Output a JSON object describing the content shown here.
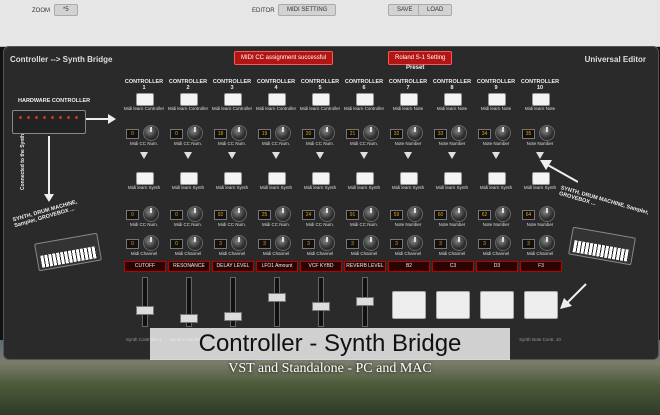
{
  "topbar": {
    "zoom_label": "ZOOM",
    "zoom_value": "*5",
    "editor_label": "EDITOR",
    "midi_setting_label": "MIDI SETTING",
    "save_label": "SAVE",
    "load_label": "LOAD"
  },
  "panel": {
    "title": "Controller --> Synth Bridge",
    "right_title": "Universal Editor",
    "status_message": "MIDI CC assignment successful",
    "preset_value": "Roland S-1 Setting",
    "preset_label": "Preset",
    "hardware_label": "HARDWARE CONTROLLER",
    "connected_label": "Connected to the Synth",
    "synth_label": "SYNTH, DRUM MACHINE, Sampler, GROVEBOX ...",
    "accent_color": "#b31515"
  },
  "controllers": [
    {
      "header": "CONTROLLER",
      "num": "1",
      "learn_top": "Midi learn Controller",
      "cc": "0",
      "cc_label": "Midi CC Num.",
      "learn_synth": "Midi learn Synth",
      "synth_cc": "0",
      "synth_cc_label": "Midi CC Num.",
      "channel": "0",
      "channel_label": "Midi Channel",
      "name": "CUTOFF",
      "type": "fader",
      "fader_level": 0.3,
      "bottom": "Synth Controller 1"
    },
    {
      "header": "CONTROLLER",
      "num": "2",
      "learn_top": "Midi learn Controller",
      "cc": "0",
      "cc_label": "Midi CC Num.",
      "learn_synth": "Midi learn Synth",
      "synth_cc": "0",
      "synth_cc_label": "Midi CC Num.",
      "channel": "0",
      "channel_label": "Midi Channel",
      "name": "RESONANCE",
      "type": "fader",
      "fader_level": 0.1,
      "bottom": "Synth Controller 2"
    },
    {
      "header": "CONTROLLER",
      "num": "3",
      "learn_top": "Midi learn Controller",
      "cc": "18",
      "cc_label": "Midi CC Num.",
      "learn_synth": "Midi learn Synth",
      "synth_cc": "92",
      "synth_cc_label": "Midi CC Num.",
      "channel": "3",
      "channel_label": "Midi Channel",
      "name": "DELAY LEVEL",
      "type": "fader",
      "fader_level": 0.15,
      "bottom": ""
    },
    {
      "header": "CONTROLLER",
      "num": "4",
      "learn_top": "Midi learn Controller",
      "cc": "19",
      "cc_label": "Midi CC Num.",
      "learn_synth": "Midi learn Synth",
      "synth_cc": "25",
      "synth_cc_label": "Midi CC Num.",
      "channel": "3",
      "channel_label": "Midi Channel",
      "name": "LFO1 Amount",
      "type": "fader",
      "fader_level": 0.6,
      "bottom": ""
    },
    {
      "header": "CONTROLLER",
      "num": "5",
      "learn_top": "Midi learn Controller",
      "cc": "20",
      "cc_label": "Midi CC Num.",
      "learn_synth": "Midi learn Synth",
      "synth_cc": "24",
      "synth_cc_label": "Midi CC Num.",
      "channel": "3",
      "channel_label": "Midi Channel",
      "name": "VCF KYBD",
      "type": "fader",
      "fader_level": 0.4,
      "bottom": ""
    },
    {
      "header": "CONTROLLER",
      "num": "6",
      "learn_top": "Midi learn Controller",
      "cc": "21",
      "cc_label": "Midi CC Num.",
      "learn_synth": "Midi learn Synth",
      "synth_cc": "91",
      "synth_cc_label": "Midi CC Num.",
      "channel": "3",
      "channel_label": "Midi Channel",
      "name": "REVERB LEVEL",
      "type": "fader",
      "fader_level": 0.5,
      "bottom": ""
    },
    {
      "header": "CONTROLLER",
      "num": "7",
      "learn_top": "Midi learn Note",
      "cc": "32",
      "cc_label": "Note Number",
      "learn_synth": "Midi learn Synth",
      "synth_cc": "59",
      "synth_cc_label": "Note Number",
      "channel": "3",
      "channel_label": "Midi Channel",
      "name": "B2",
      "type": "pad",
      "bottom": ""
    },
    {
      "header": "CONTROLLER",
      "num": "8",
      "learn_top": "Midi learn Note",
      "cc": "33",
      "cc_label": "Note Number",
      "learn_synth": "Midi learn Synth",
      "synth_cc": "60",
      "synth_cc_label": "Note Number",
      "channel": "3",
      "channel_label": "Midi Channel",
      "name": "C3",
      "type": "pad",
      "bottom": ""
    },
    {
      "header": "CONTROLLER",
      "num": "9",
      "learn_top": "Midi learn Note",
      "cc": "34",
      "cc_label": "Note Number",
      "learn_synth": "Midi learn Synth",
      "synth_cc": "62",
      "synth_cc_label": "Note Number",
      "channel": "3",
      "channel_label": "Midi Channel",
      "name": "D3",
      "type": "pad",
      "bottom": ""
    },
    {
      "header": "CONTROLLER",
      "num": "10",
      "learn_top": "Midi learn Note",
      "cc": "35",
      "cc_label": "Note Number",
      "learn_synth": "Midi learn Synth",
      "synth_cc": "64",
      "synth_cc_label": "Note Number",
      "channel": "3",
      "channel_label": "Midi Channel",
      "name": "F3",
      "type": "pad",
      "bottom": "Synth Note Contr. 10"
    }
  ],
  "banner": {
    "title": "Controller - Synth Bridge",
    "subtitle": "VST and Standalone - PC and MAC"
  }
}
